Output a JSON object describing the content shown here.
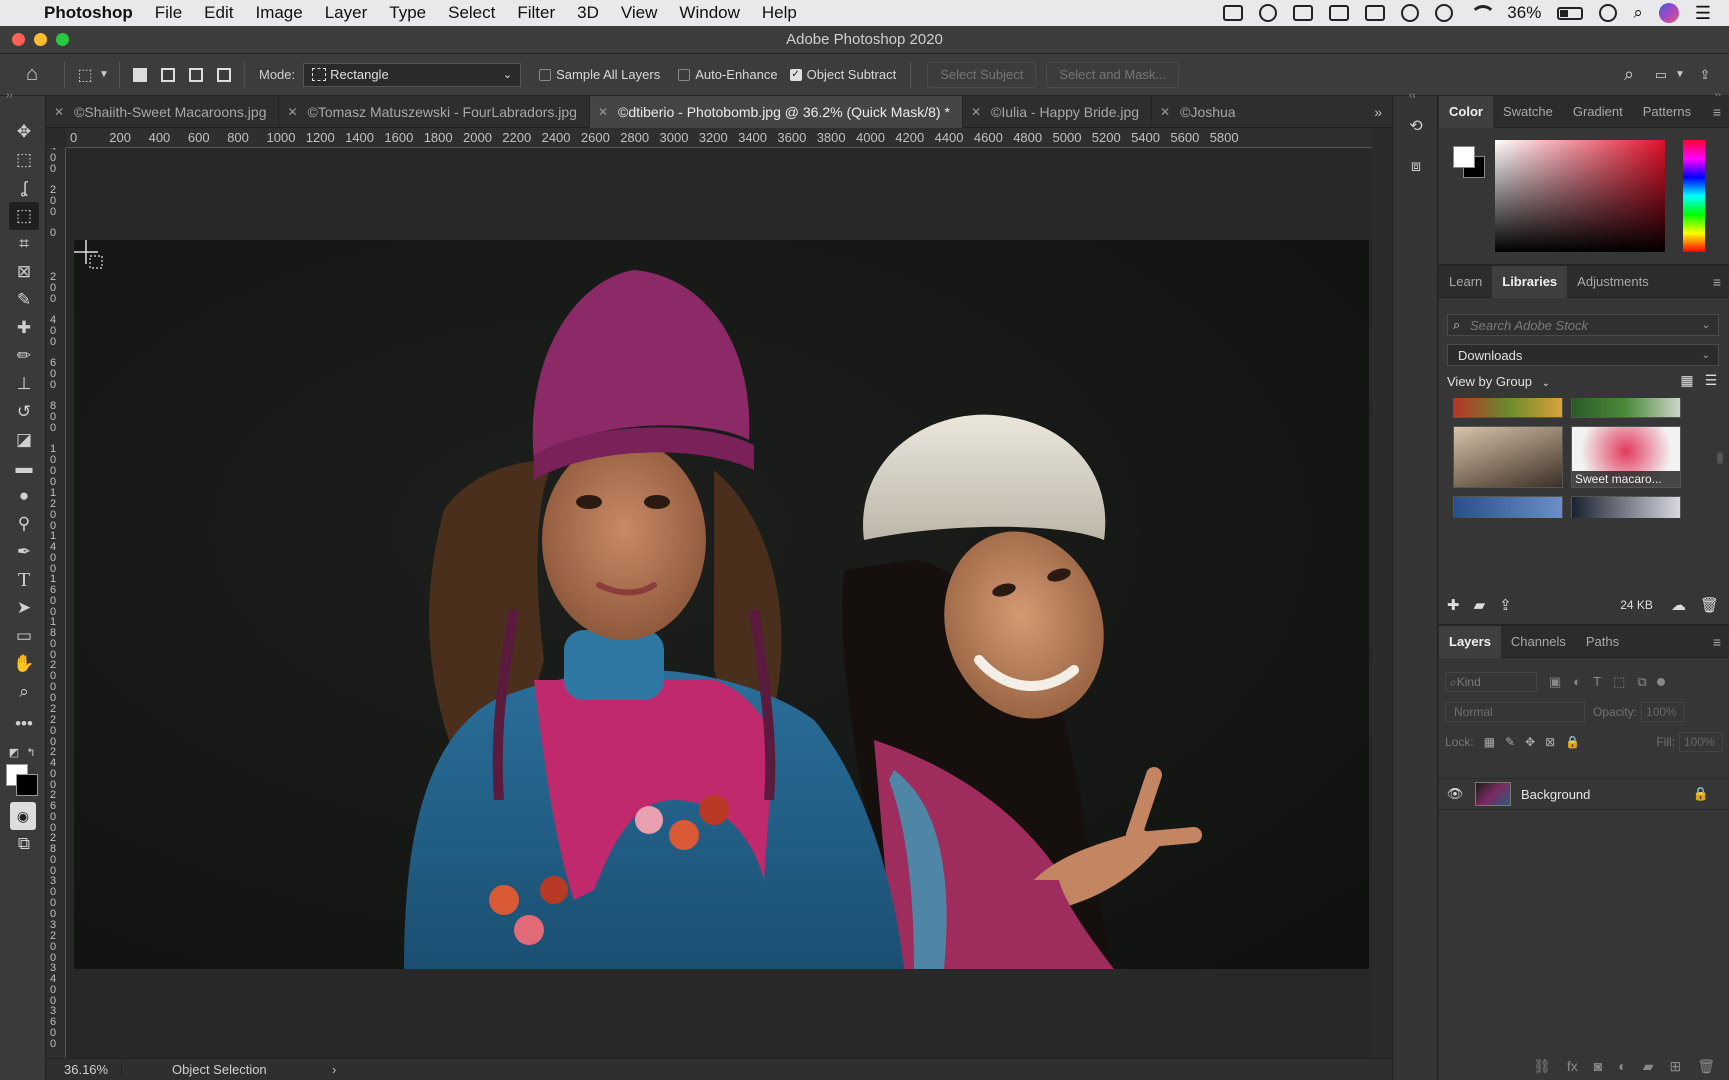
{
  "menubar": {
    "app_name": "Photoshop",
    "items": [
      "File",
      "Edit",
      "Image",
      "Layer",
      "Type",
      "Select",
      "Filter",
      "3D",
      "View",
      "Window",
      "Help"
    ],
    "battery_percent": "36%"
  },
  "window": {
    "title": "Adobe Photoshop 2020"
  },
  "options_bar": {
    "mode_label": "Mode:",
    "mode_value": "Rectangle",
    "sample_all_layers": {
      "label": "Sample All Layers",
      "checked": false
    },
    "auto_enhance": {
      "label": "Auto-Enhance",
      "checked": false
    },
    "object_subtract": {
      "label": "Object Subtract",
      "checked": true
    },
    "select_subject_label": "Select Subject",
    "select_and_mask_label": "Select and Mask..."
  },
  "tabs": [
    {
      "label": "©Shaiith-Sweet Macaroons.jpg",
      "active": false
    },
    {
      "label": "©Tomasz Matuszewski - FourLabradors.jpg",
      "active": false
    },
    {
      "label": "©dtiberio - Photobomb.jpg @ 36.2% (Quick Mask/8) *",
      "active": true
    },
    {
      "label": "©Iulia - Happy Bride.jpg",
      "active": false
    },
    {
      "label": "©Joshua",
      "active": false
    }
  ],
  "rulers": {
    "horizontal": [
      "0",
      "200",
      "400",
      "600",
      "800",
      "1000",
      "1200",
      "1400",
      "1600",
      "1800",
      "2000",
      "2200",
      "2400",
      "2600",
      "2800",
      "3000",
      "3200",
      "3400",
      "3600",
      "3800",
      "4000",
      "4200",
      "4400",
      "4600",
      "4800",
      "5000",
      "5200",
      "5400",
      "5600",
      "5800"
    ],
    "vertical": [
      "400",
      "200",
      "0",
      "200",
      "400",
      "600",
      "800",
      "1000",
      "1200",
      "1400",
      "1600",
      "1800",
      "2000",
      "2200",
      "2400",
      "2600",
      "2800",
      "3000",
      "3200",
      "3400",
      "3600"
    ]
  },
  "color_panel": {
    "tabs": [
      "Color",
      "Swatche",
      "Gradient",
      "Patterns"
    ],
    "foreground": "#ffffff",
    "background": "#000000",
    "hue_color": "#e0102a"
  },
  "libraries_panel": {
    "tabs": [
      "Learn",
      "Libraries",
      "Adjustments"
    ],
    "search_placeholder": "Search Adobe Stock",
    "library_name": "Downloads",
    "view_by": "View by Group",
    "thumb_caption": "Sweet macaro...",
    "size": "24 KB"
  },
  "layers_panel": {
    "tabs": [
      "Layers",
      "Channels",
      "Paths"
    ],
    "kind_label": "Kind",
    "blend_mode": "Normal",
    "opacity_label": "Opacity:",
    "opacity_value": "100%",
    "lock_label": "Lock:",
    "fill_label": "Fill:",
    "fill_value": "100%",
    "layer_name": "Background"
  },
  "status_bar": {
    "zoom": "36.16%",
    "info": "Object Selection"
  },
  "tools": [
    "move-tool",
    "marquee-tool",
    "lasso-tool",
    "object-selection-tool",
    "crop-tool",
    "frame-tool",
    "eyedropper-tool",
    "healing-brush-tool",
    "brush-tool",
    "clone-stamp-tool",
    "history-brush-tool",
    "eraser-tool",
    "gradient-tool",
    "blur-tool",
    "dodge-tool",
    "pen-tool",
    "type-tool",
    "path-selection-tool",
    "rectangle-tool",
    "hand-tool",
    "zoom-tool",
    "more-tools"
  ]
}
